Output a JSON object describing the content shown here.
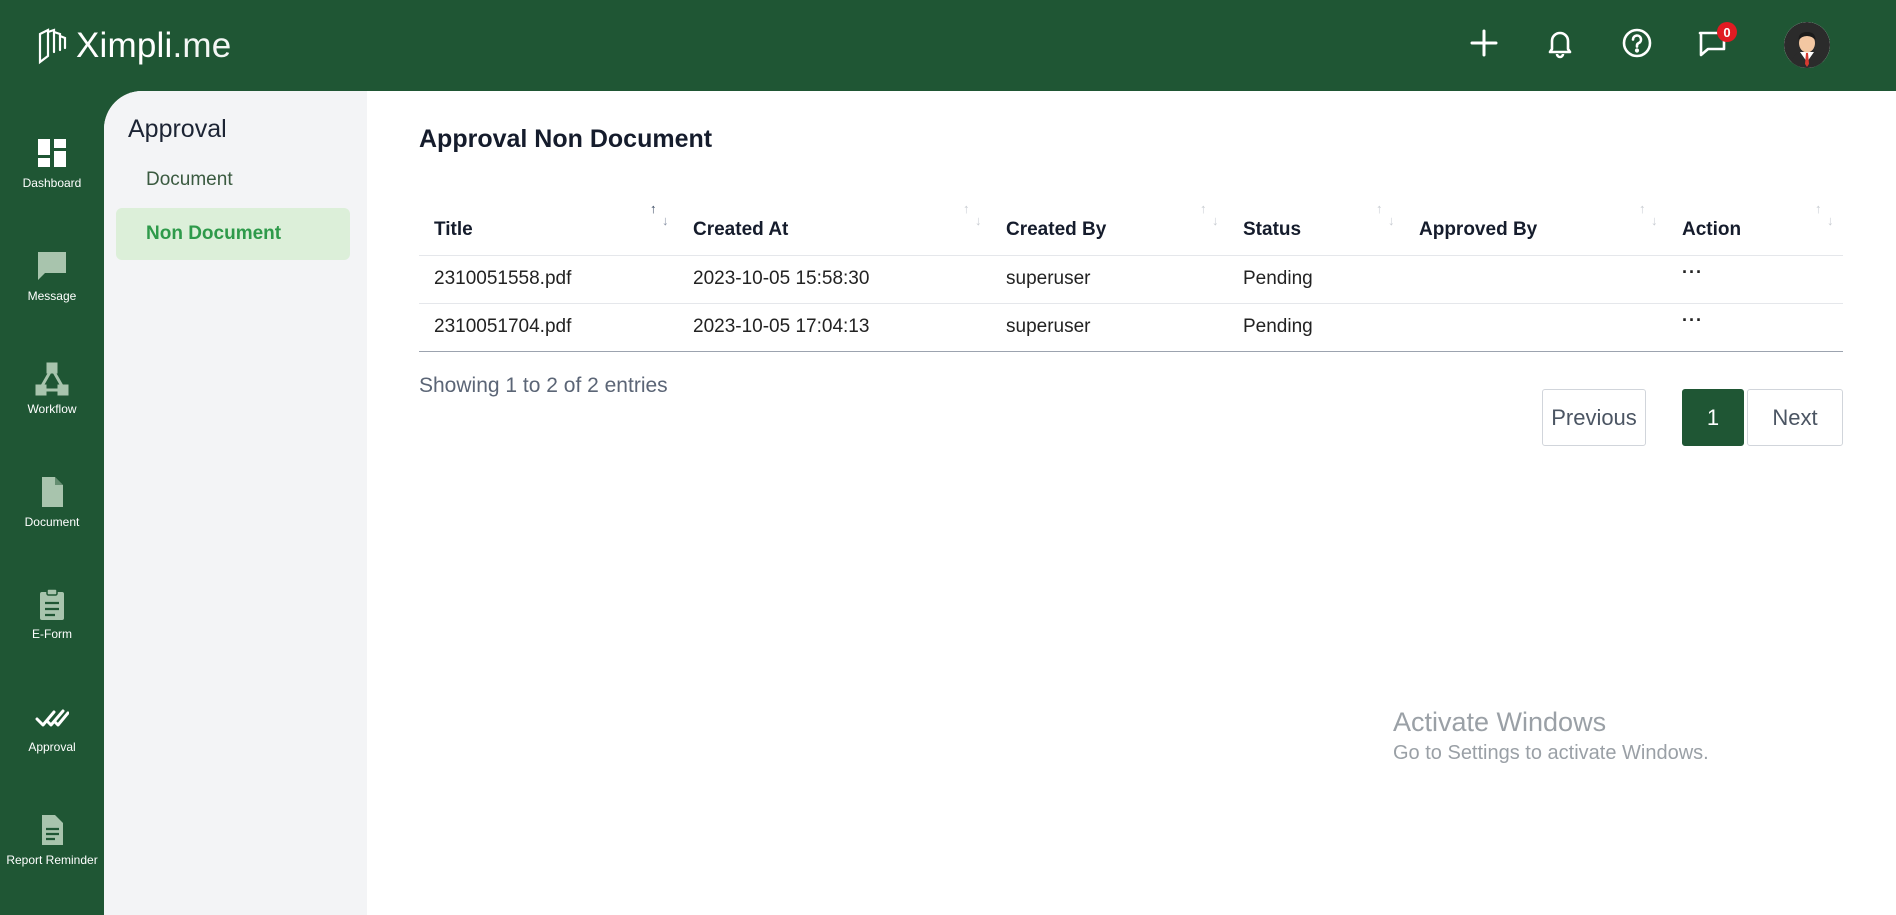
{
  "app": {
    "logo_text": "Ximpli",
    "logo_suffix": ".me"
  },
  "topbar": {
    "icons": [
      "plus-icon",
      "bell-icon",
      "help-icon",
      "chat-icon"
    ],
    "message_count": "0"
  },
  "rail": {
    "items": [
      {
        "label": "Dashboard",
        "icon": "dashboard-icon"
      },
      {
        "label": "Message",
        "icon": "message-icon"
      },
      {
        "label": "Workflow",
        "icon": "workflow-icon"
      },
      {
        "label": "Document",
        "icon": "document-icon"
      },
      {
        "label": "E-Form",
        "icon": "clipboard-icon"
      },
      {
        "label": "Approval",
        "icon": "double-check-icon"
      },
      {
        "label": "Report Reminder",
        "icon": "report-icon"
      }
    ]
  },
  "subnav": {
    "title": "Approval",
    "items": [
      {
        "label": "Document",
        "active": false
      },
      {
        "label": "Non Document",
        "active": true
      }
    ]
  },
  "main": {
    "title": "Approval Non Document",
    "table": {
      "columns": [
        "Title",
        "Created At",
        "Created By",
        "Status",
        "Approved By",
        "Action"
      ],
      "rows": [
        {
          "title": "2310051558.pdf",
          "created_at": "2023-10-05 15:58:30",
          "created_by": "superuser",
          "status": "Pending",
          "approved_by": "",
          "action": "···"
        },
        {
          "title": "2310051704.pdf",
          "created_at": "2023-10-05 17:04:13",
          "created_by": "superuser",
          "status": "Pending",
          "approved_by": "",
          "action": "···"
        }
      ]
    },
    "showing": "Showing 1 to 2 of 2 entries",
    "pagination": {
      "previous": "Previous",
      "current": "1",
      "next": "Next"
    }
  },
  "watermark": {
    "line1": "Activate Windows",
    "line2": "Go to Settings to activate Windows."
  },
  "colors": {
    "brand": "#1f5634",
    "active_text": "#2e9a4a",
    "active_bg": "#dcefd9",
    "badge": "#e01b22"
  }
}
